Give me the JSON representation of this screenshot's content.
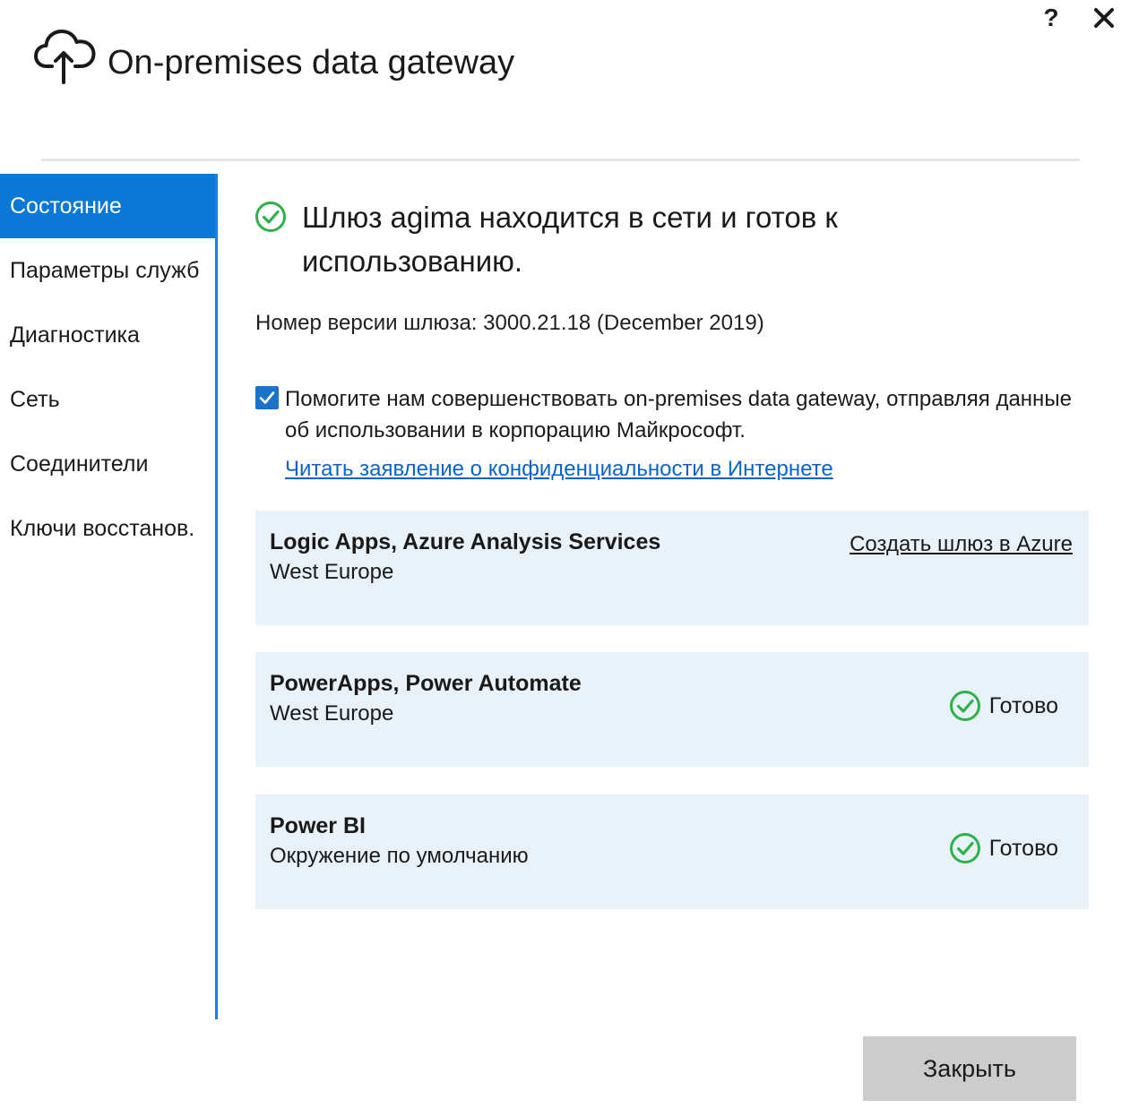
{
  "app": {
    "title": "On-premises data gateway",
    "help_label": "?",
    "icon": "cloud-upload-icon"
  },
  "sidebar": {
    "items": [
      {
        "label": "Состояние",
        "active": true
      },
      {
        "label": "Параметры служб",
        "active": false
      },
      {
        "label": "Диагностика",
        "active": false
      },
      {
        "label": "Сеть",
        "active": false
      },
      {
        "label": "Соединители",
        "active": false
      },
      {
        "label": "Ключи восстанов.",
        "active": false
      }
    ]
  },
  "main": {
    "status_message": "Шлюз agima находится в сети и готов к использованию.",
    "version_text": "Номер версии шлюза: 3000.21.18 (December 2019)",
    "consent": {
      "checked": true,
      "text": "Помогите нам совершенствовать on-premises data gateway, отправляя данные об использовании в корпорацию Майкрософт."
    },
    "privacy_link": "Читать заявление о конфиденциальности в Интернете",
    "services": [
      {
        "title": "Logic Apps, Azure Analysis Services",
        "region": "West Europe",
        "action_link": "Создать шлюз в Azure"
      },
      {
        "title": "PowerApps, Power Automate",
        "region": "West Europe",
        "status": "Готово"
      },
      {
        "title": "Power BI",
        "region": "Окружение по умолчанию",
        "status": "Готово"
      }
    ]
  },
  "footer": {
    "close_label": "Закрыть"
  },
  "colors": {
    "accent": "#0a78d4",
    "success": "#2db24a",
    "card_background": "#e9f1f9",
    "link": "#0a64c8",
    "button_gray": "#cccccc"
  }
}
